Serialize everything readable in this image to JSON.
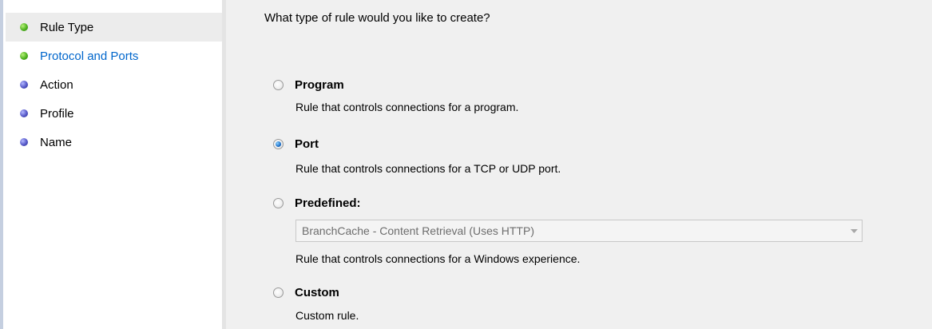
{
  "steps": [
    {
      "label": "Rule Type",
      "status": "complete",
      "selected": true
    },
    {
      "label": "Protocol and Ports",
      "status": "complete",
      "selected": false
    },
    {
      "label": "Action",
      "status": "pending",
      "selected": false
    },
    {
      "label": "Profile",
      "status": "pending",
      "selected": false
    },
    {
      "label": "Name",
      "status": "pending",
      "selected": false
    }
  ],
  "main": {
    "question": "What type of rule would you like to create?",
    "options": [
      {
        "label": "Program",
        "description": "Rule that controls connections for a program.",
        "checked": false
      },
      {
        "label": "Port",
        "description": "Rule that controls connections for a TCP or UDP port.",
        "checked": true
      },
      {
        "label": "Predefined:",
        "description": "Rule that controls connections for a Windows experience.",
        "checked": false
      },
      {
        "label": "Custom",
        "description": "Custom rule.",
        "checked": false
      }
    ],
    "predefined_select": {
      "value": "BranchCache - Content Retrieval (Uses HTTP)",
      "disabled": true
    }
  },
  "colors": {
    "complete_dot": "#4fb320",
    "pending_dot": "#5558c8",
    "link_text": "#0066cc"
  },
  "icons": {
    "complete": "green-dot-icon",
    "pending": "blue-dot-icon",
    "dropdown": "chevron-down-icon"
  }
}
